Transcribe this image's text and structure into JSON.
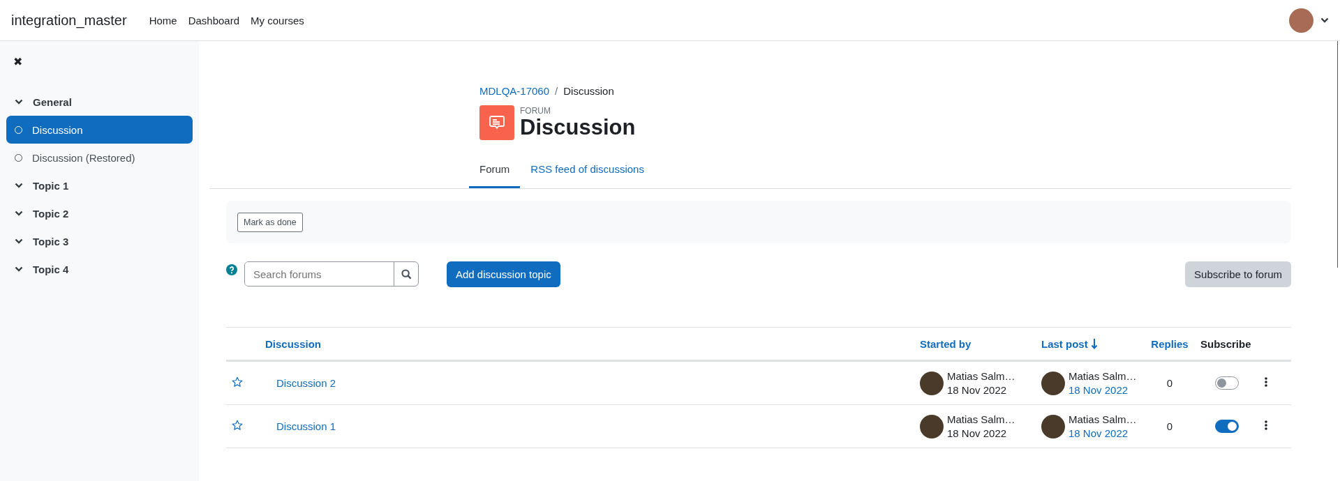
{
  "navbar": {
    "site_name": "integration_master",
    "links": [
      {
        "label": "Home"
      },
      {
        "label": "Dashboard"
      },
      {
        "label": "My courses"
      }
    ]
  },
  "sidebar": {
    "close_icon": "✖",
    "items": [
      {
        "kind": "section",
        "label": "General",
        "selected": false
      },
      {
        "kind": "activity",
        "label": "Discussion",
        "selected": true
      },
      {
        "kind": "activity",
        "label": "Discussion (Restored)",
        "selected": false
      },
      {
        "kind": "section",
        "label": "Topic 1",
        "selected": false
      },
      {
        "kind": "section",
        "label": "Topic 2",
        "selected": false
      },
      {
        "kind": "section",
        "label": "Topic 3",
        "selected": false
      },
      {
        "kind": "section",
        "label": "Topic 4",
        "selected": false
      }
    ]
  },
  "breadcrumb": [
    {
      "label": "MDLQA-17060",
      "link": true
    },
    {
      "label": "Discussion",
      "link": false
    }
  ],
  "breadcrumb_separator": "/",
  "header": {
    "kicker": "FORUM",
    "title": "Discussion"
  },
  "tabs": [
    {
      "label": "Forum",
      "selected": true
    },
    {
      "label": "RSS feed of discussions",
      "selected": false
    }
  ],
  "completion": {
    "button": "Mark as done"
  },
  "search": {
    "placeholder": "Search forums"
  },
  "add_button": "Add discussion topic",
  "subscribe_button": "Subscribe to forum",
  "table": {
    "columns": [
      {
        "label": "Discussion",
        "link": true,
        "sorted": false
      },
      {
        "label": "Started by",
        "link": true,
        "sorted": false
      },
      {
        "label": "Last post",
        "link": true,
        "sorted": true
      },
      {
        "label": "Replies",
        "link": true,
        "sorted": false
      },
      {
        "label": "Subscribe",
        "link": false,
        "sorted": false
      }
    ],
    "rows": [
      {
        "starred": false,
        "title": "Discussion 2",
        "started_by": "Matias Salm…",
        "started_date": "18 Nov 2022",
        "last_by": "Matias Salm…",
        "last_date": "18 Nov 2022",
        "replies": "0",
        "subscribed": false
      },
      {
        "starred": false,
        "title": "Discussion 1",
        "started_by": "Matias Salm…",
        "started_date": "18 Nov 2022",
        "last_by": "Matias Salm…",
        "last_date": "18 Nov 2022",
        "replies": "0",
        "subscribed": true
      }
    ]
  }
}
